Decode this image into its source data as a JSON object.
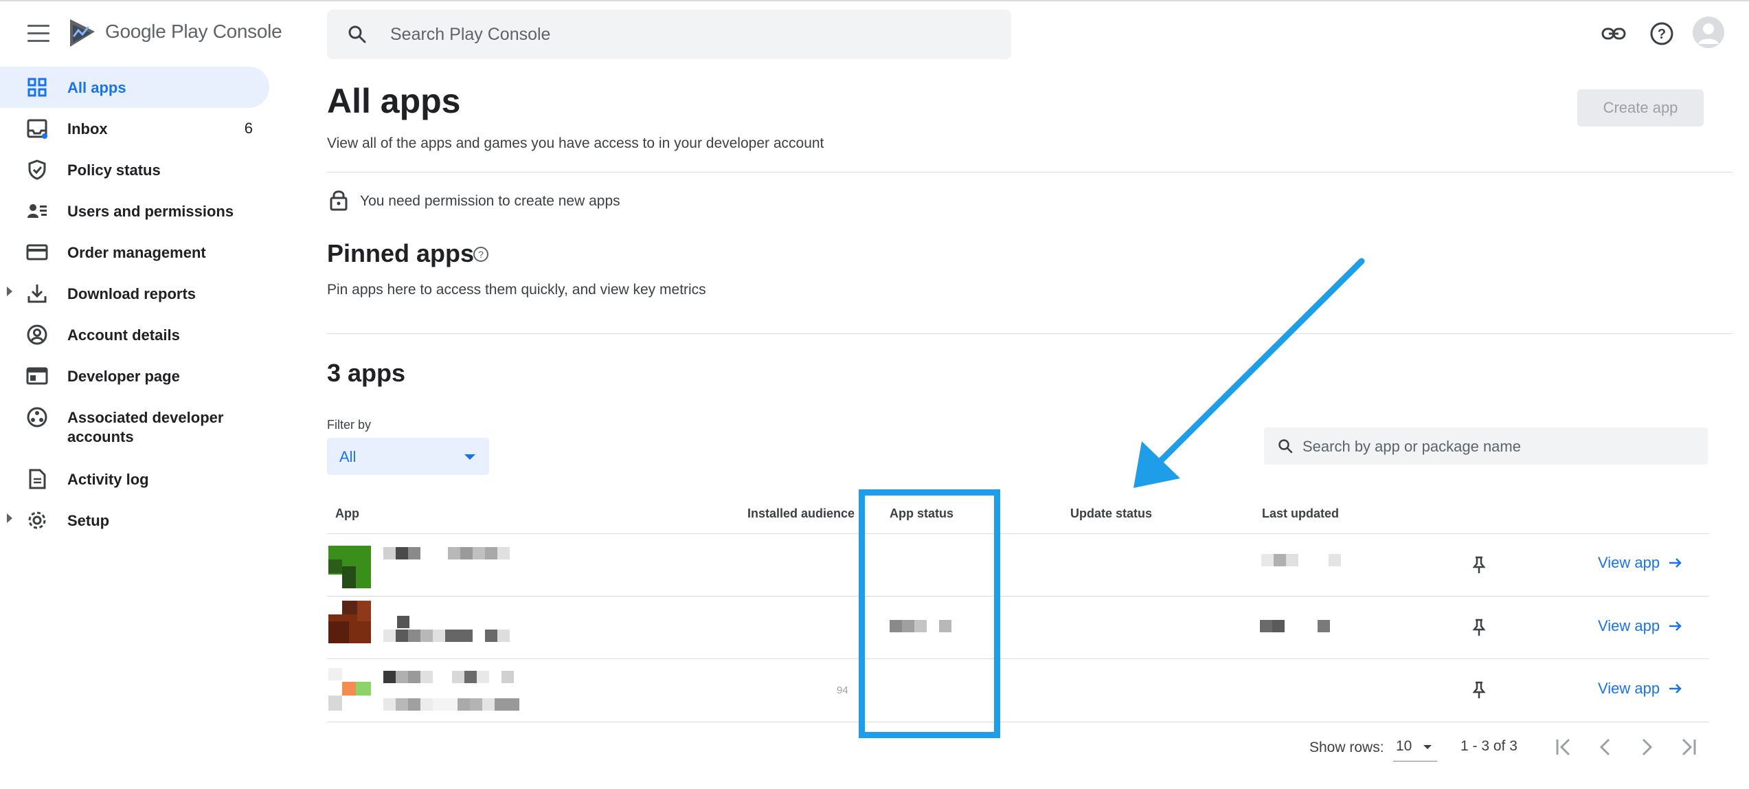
{
  "header": {
    "brand": "Google Play Console",
    "search_placeholder": "Search Play Console"
  },
  "sidebar": {
    "items": [
      {
        "label": "All apps",
        "icon": "grid-icon",
        "active": true
      },
      {
        "label": "Inbox",
        "icon": "inbox-icon",
        "badge": "6"
      },
      {
        "label": "Policy status",
        "icon": "shield-icon"
      },
      {
        "label": "Users and permissions",
        "icon": "users-icon"
      },
      {
        "label": "Order management",
        "icon": "credit-card-icon"
      },
      {
        "label": "Download reports",
        "icon": "download-icon",
        "expandable": true
      },
      {
        "label": "Account details",
        "icon": "account-circle-icon"
      },
      {
        "label": "Developer page",
        "icon": "web-page-icon"
      },
      {
        "label": "Associated developer accounts",
        "label_line1": "Associated developer",
        "label_line2": "accounts",
        "icon": "linked-accounts-icon"
      },
      {
        "label": "Activity log",
        "icon": "document-icon"
      },
      {
        "label": "Setup",
        "icon": "gear-icon",
        "expandable": true
      }
    ]
  },
  "main": {
    "title": "All apps",
    "subtitle": "View all of the apps and games you have access to in your developer account",
    "create_button": "Create app",
    "permission_notice": "You need permission to create new apps",
    "pinned_title": "Pinned apps",
    "pinned_subtitle": "Pin apps here to access them quickly, and view key metrics",
    "count_title": "3 apps",
    "filter_label": "Filter by",
    "filter_value": "All",
    "table_search_placeholder": "Search by app or package name",
    "columns": [
      "App",
      "Installed audience",
      "App status",
      "Update status",
      "Last updated"
    ],
    "rows": [
      {
        "action": "View app"
      },
      {
        "action": "View app"
      },
      {
        "action": "View app",
        "audience_fragment": "94"
      }
    ]
  },
  "pagination": {
    "rows_label": "Show rows:",
    "rows_value": "10",
    "range": "1 - 3 of 3"
  },
  "colors": {
    "accent": "#1a73e8",
    "active_bg": "#e8f0fe",
    "annotation": "#1e9ee8"
  }
}
